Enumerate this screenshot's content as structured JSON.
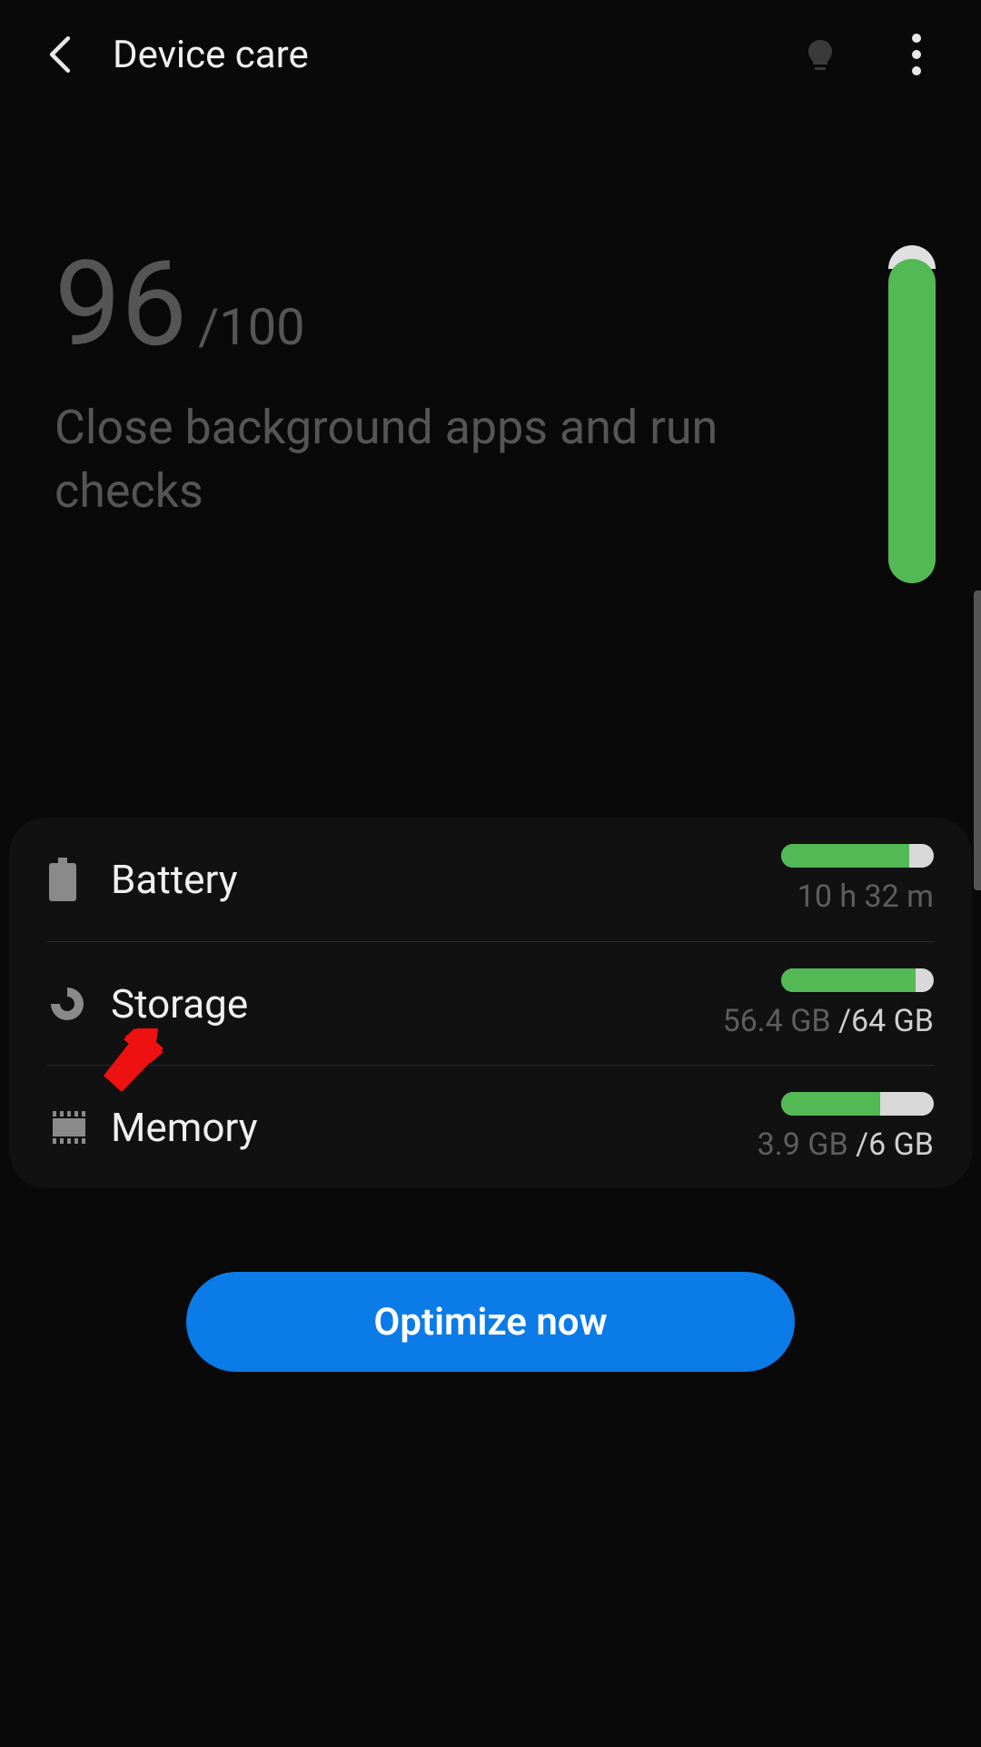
{
  "header": {
    "title": "Device care"
  },
  "score": {
    "value": "96",
    "max_sep": "/",
    "max": "100",
    "message": "Close background apps and run checks",
    "bar_pct": 96
  },
  "items": [
    {
      "label": "Battery",
      "icon": "battery",
      "sub_dim": "10 h 32 m",
      "sub_strong": "",
      "bar_pct": 84
    },
    {
      "label": "Storage",
      "icon": "donut",
      "sub_dim": "56.4 GB ",
      "sub_strong": "/64 GB",
      "bar_pct": 88
    },
    {
      "label": "Memory",
      "icon": "chip",
      "sub_dim": "3.9 GB ",
      "sub_strong": "/6 GB",
      "bar_pct": 65
    }
  ],
  "cta": {
    "label": "Optimize now"
  },
  "annotation": {
    "arrow_points_to": "Storage"
  }
}
